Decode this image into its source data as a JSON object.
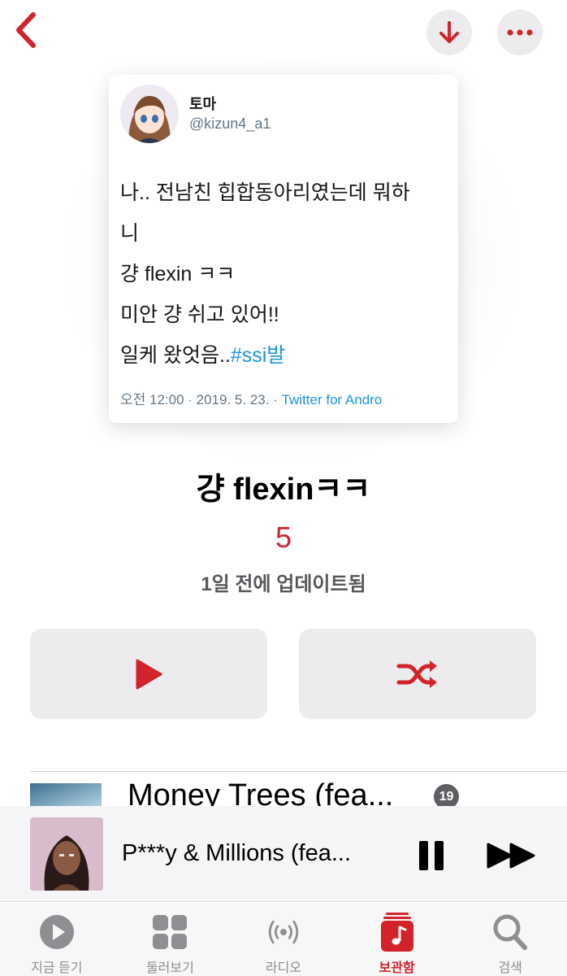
{
  "colors": {
    "accent": "#d2232a",
    "hashtag": "#1b95e0",
    "button_bg": "#ececee",
    "tab_inactive": "#8e8e93"
  },
  "header": {
    "back_icon": "chevron-left-icon",
    "download_icon": "arrow-down-icon",
    "more_icon": "ellipsis-icon"
  },
  "tweet": {
    "name": "토마",
    "handle": "@kizun4_a1",
    "lines": [
      "나.. 전남친 힙합동아리였는데 뭐하",
      "니",
      " 걍 flexin ㅋㅋ",
      "미안 걍 쉬고 있어!!"
    ],
    "last_line_text": "일케 왔엇음..",
    "hashtag": "#ssi발",
    "meta": "오전 12:00 · 2019. 5. 23. · ",
    "source": "Twitter for Andro"
  },
  "playlist": {
    "title": "걍 flexinㅋㅋ",
    "count": "5",
    "updated": "1일 전에 업데이트됨",
    "play_icon": "play-icon",
    "shuffle_icon": "shuffle-icon"
  },
  "tracks": [
    {
      "title": "Money Trees (fea...",
      "badge": "19"
    }
  ],
  "now_playing": {
    "title": "P***y & Millions (fea...",
    "pause_icon": "pause-icon",
    "forward_icon": "fast-forward-icon"
  },
  "tabs": [
    {
      "label": "지금 듣기",
      "icon": "play-circle-icon"
    },
    {
      "label": "둘러보기",
      "icon": "grid-icon"
    },
    {
      "label": "라디오",
      "icon": "radio-waves-icon"
    },
    {
      "label": "보관함",
      "icon": "library-icon",
      "active": true
    },
    {
      "label": "검색",
      "icon": "search-icon"
    }
  ]
}
